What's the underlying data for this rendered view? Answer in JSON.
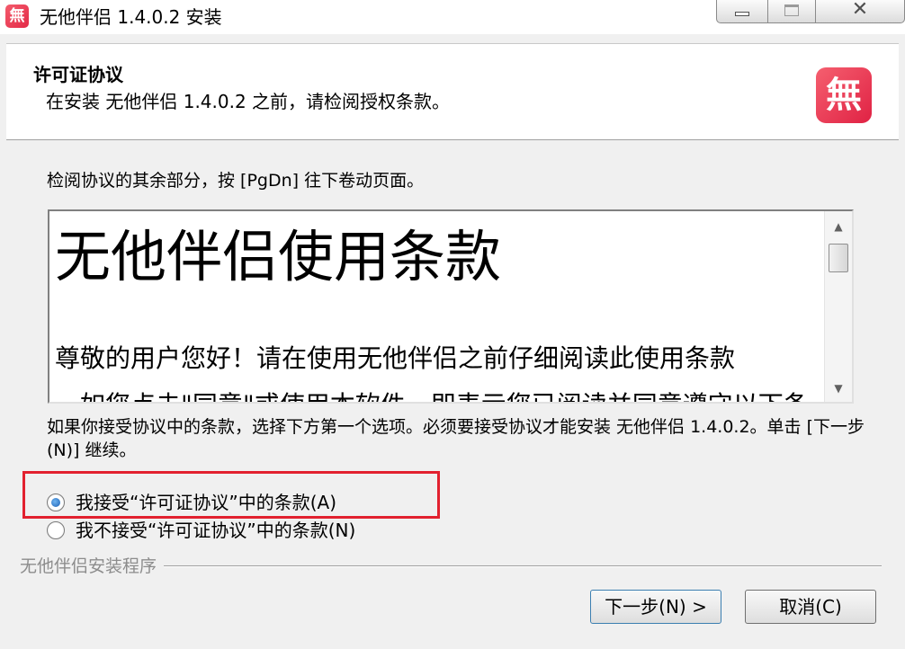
{
  "window": {
    "title": "无他伴侣 1.4.0.2 安装",
    "app_icon_glyph": "無",
    "controls": {
      "minimize_icon": "minimize-icon",
      "maximize_icon": "maximize-icon",
      "close_icon": "close-icon",
      "close_glyph": "✕"
    }
  },
  "header": {
    "title": "许可证协议",
    "subtitle": "在安装 无他伴侣 1.4.0.2 之前，请检阅授权条款。",
    "logo_glyph": "無"
  },
  "body": {
    "instruction": "检阅协议的其余部分，按 [PgDn] 往下卷动页面。",
    "license": {
      "heading": "无他伴侣使用条款",
      "paragraph": "尊敬的用户您好！请在使用无他伴侣之前仔细阅读此使用条款",
      "cutoff_line": "，如您点击\"同意\"或使用本软件，即表示您已阅读并同意遵守以下条"
    },
    "scroll_up_glyph": "▲",
    "scroll_down_glyph": "▼",
    "accept_note": "如果你接受协议中的条款，选择下方第一个选项。必须要接受协议才能安装 无他伴侣 1.4.0.2。单击 [下一步(N)] 继续。",
    "options": {
      "accept": "我接受“许可证协议”中的条款(A)",
      "decline": "我不接受“许可证协议”中的条款(N)",
      "selected": "accept"
    }
  },
  "footer": {
    "brand": "无他伴侣安装程序",
    "next_label": "下一步(N) >",
    "cancel_label": "取消(C)"
  },
  "colors": {
    "highlight": "#e2212f",
    "brand_red": "#e32a47"
  }
}
